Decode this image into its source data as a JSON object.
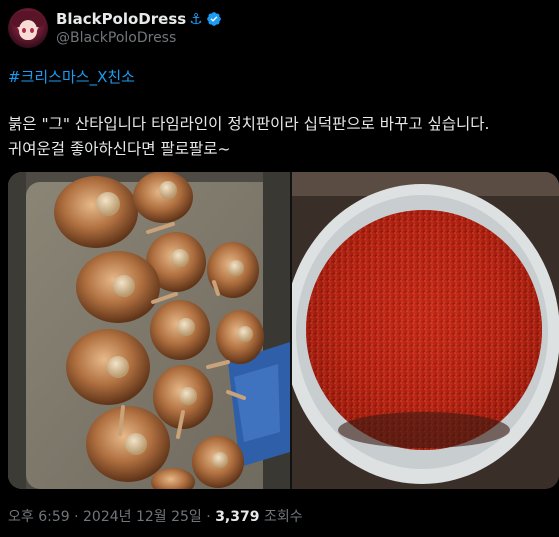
{
  "author": {
    "display_name": "BlackPoloDress",
    "name_emoji": "⚓",
    "handle": "@BlackPoloDress",
    "verified": true
  },
  "tweet": {
    "hashtags": "#크리스마스_X친소",
    "line1": "붉은 \"그\" 산타입니다 타임라인이 정치판이라 십덕판으로 바꾸고 싶습니다.",
    "line2": "귀여운걸 좋아하신다면 팔로팔로~"
  },
  "media": {
    "left_photo": "bowls-with-spoons-photo",
    "right_photo": "red-pepper-flakes-bowl-photo"
  },
  "footer": {
    "time": "오후 6:59",
    "sep1": "·",
    "date": "2024년 12월 25일",
    "sep2": "·",
    "views": "3,379",
    "views_label": "조회수"
  },
  "colors": {
    "background": "#000000",
    "text": "#e7e9ea",
    "secondary": "#71767b",
    "link": "#1d9bf0"
  }
}
